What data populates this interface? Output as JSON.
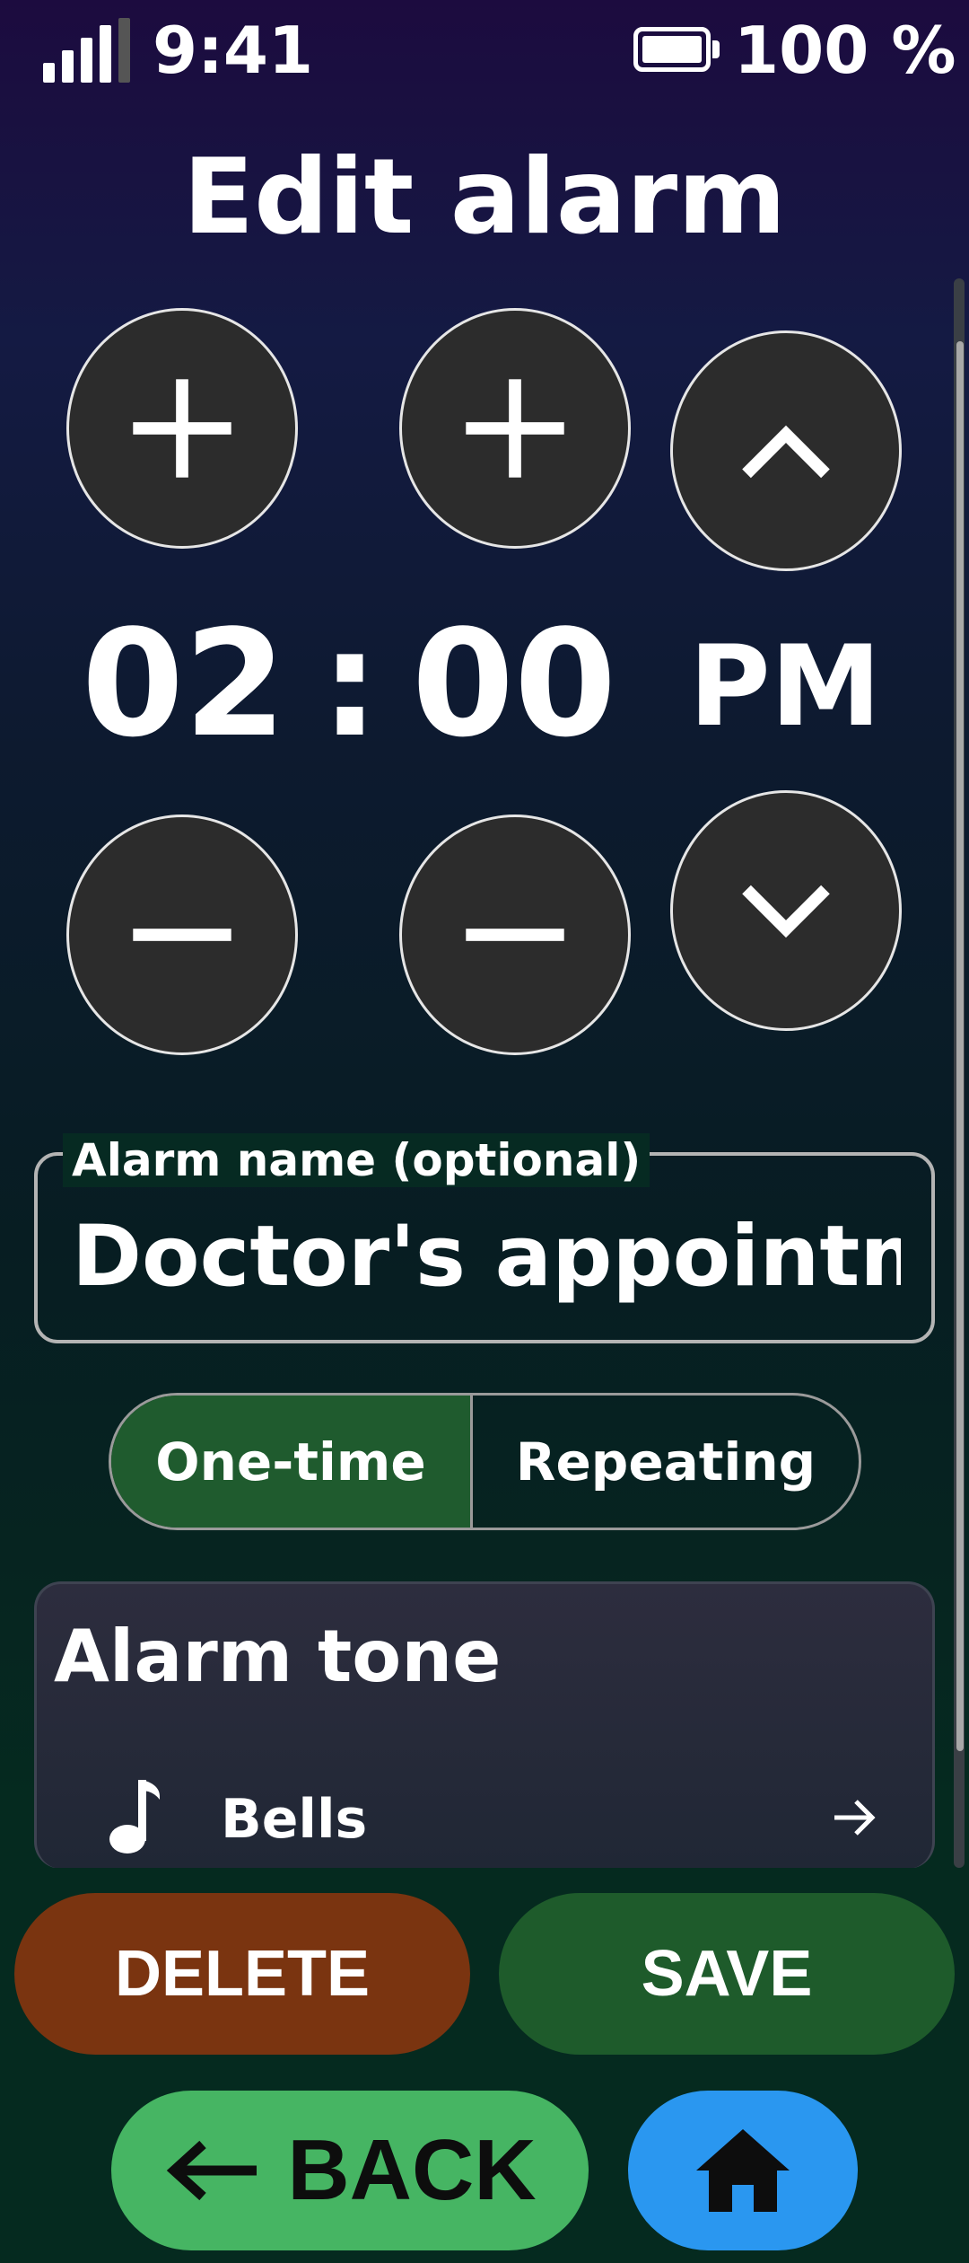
{
  "status_bar": {
    "time": "9:41",
    "battery": "100 %",
    "signal_icon": "signal-bars-icon",
    "battery_icon": "battery-full-icon"
  },
  "title": "Edit alarm",
  "time_picker": {
    "hour": "02",
    "separator": ":",
    "minute": "00",
    "period": "PM",
    "icons": {
      "increase": "plus-icon",
      "decrease": "minus-icon",
      "period_up": "chevron-up-icon",
      "period_down": "chevron-down-icon"
    }
  },
  "name_field": {
    "label": "Alarm name (optional)",
    "value": "Doctor's appointment"
  },
  "alarm_type": {
    "options": [
      "One-time",
      "Repeating"
    ],
    "selected": "One-time"
  },
  "alarm_tone": {
    "title": "Alarm tone",
    "tone": "Bells",
    "icon": "music-note-icon",
    "arrow_icon": "arrow-right-icon"
  },
  "actions": {
    "delete": "DELETE",
    "save": "SAVE",
    "back": "BACK",
    "home_icon": "home-icon"
  },
  "colors": {
    "delete": "#7a3410",
    "save": "#1e5b2b",
    "selected_segment": "#1f5b2e",
    "back": "#46b563",
    "home": "#2a97f0",
    "button_fill": "#2c2c2c"
  }
}
